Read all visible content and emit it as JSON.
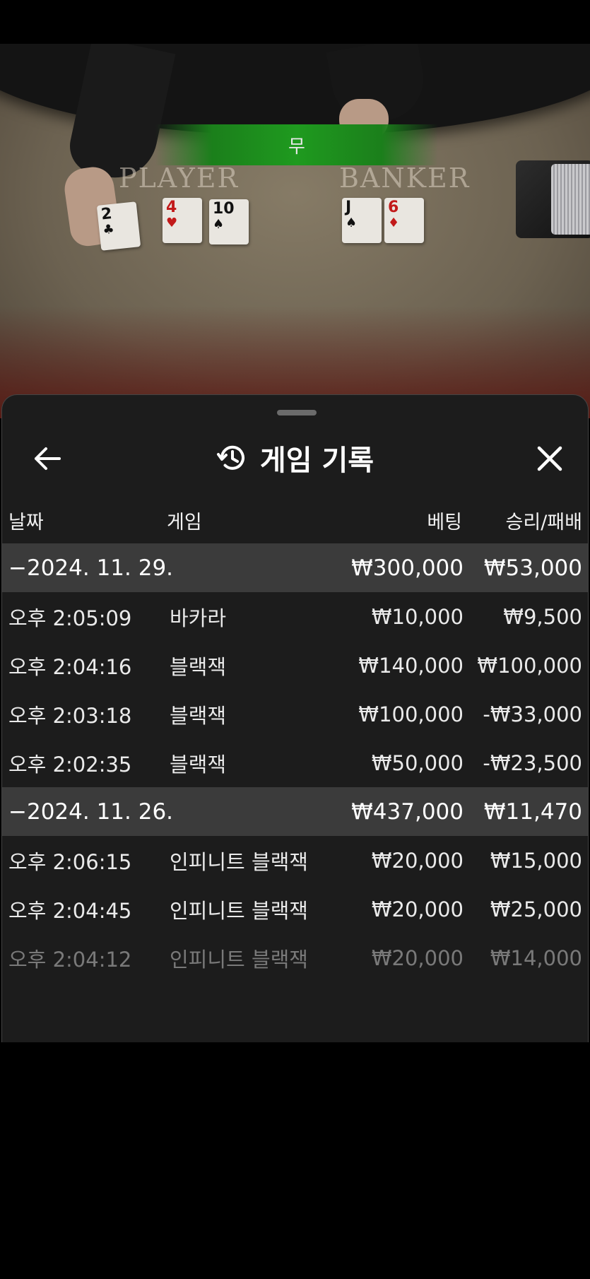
{
  "video": {
    "result_text": "무",
    "felt_player": "PLAYER",
    "felt_banker": "BANKER",
    "player_cards": [
      {
        "rank": "2",
        "suit": "♣",
        "color": "black"
      },
      {
        "rank": "4",
        "suit": "♥",
        "color": "red"
      },
      {
        "rank": "10",
        "suit": "♠",
        "color": "black"
      }
    ],
    "banker_cards": [
      {
        "rank": "J",
        "suit": "♠",
        "color": "black"
      },
      {
        "rank": "6",
        "suit": "♦",
        "color": "red"
      }
    ]
  },
  "sheet": {
    "title": "게임 기록",
    "back_icon": "arrow-left-icon",
    "history_icon": "history-clock-icon",
    "close_icon": "close-icon"
  },
  "columns": {
    "date": "날짜",
    "game": "게임",
    "bet": "베팅",
    "win_loss": "승리/패배"
  },
  "groups": [
    {
      "date": "−2024. 11. 29.",
      "total_bet": "₩300,000",
      "total_win": "₩53,000",
      "rows": [
        {
          "time": "오후 2:05:09",
          "game": "바카라",
          "bet": "₩10,000",
          "win": "₩9,500"
        },
        {
          "time": "오후 2:04:16",
          "game": "블랙잭",
          "bet": "₩140,000",
          "win": "₩100,000"
        },
        {
          "time": "오후 2:03:18",
          "game": "블랙잭",
          "bet": "₩100,000",
          "win": "-₩33,000"
        },
        {
          "time": "오후 2:02:35",
          "game": "블랙잭",
          "bet": "₩50,000",
          "win": "-₩23,500"
        }
      ]
    },
    {
      "date": "−2024. 11. 26.",
      "total_bet": "₩437,000",
      "total_win": "₩11,470",
      "rows": [
        {
          "time": "오후 2:06:15",
          "game": "인피니트 블랙잭",
          "bet": "₩20,000",
          "win": "₩15,000"
        },
        {
          "time": "오후 2:04:45",
          "game": "인피니트 블랙잭",
          "bet": "₩20,000",
          "win": "₩25,000"
        },
        {
          "time": "오후 2:04:12",
          "game": "인피니트 블랙잭",
          "bet": "₩20,000",
          "win": "₩14,000"
        }
      ]
    }
  ],
  "colors": {
    "sheet_bg": "#1c1c1c",
    "group_bg": "#3b3b3b",
    "result_banner": "#1f9a1f"
  }
}
